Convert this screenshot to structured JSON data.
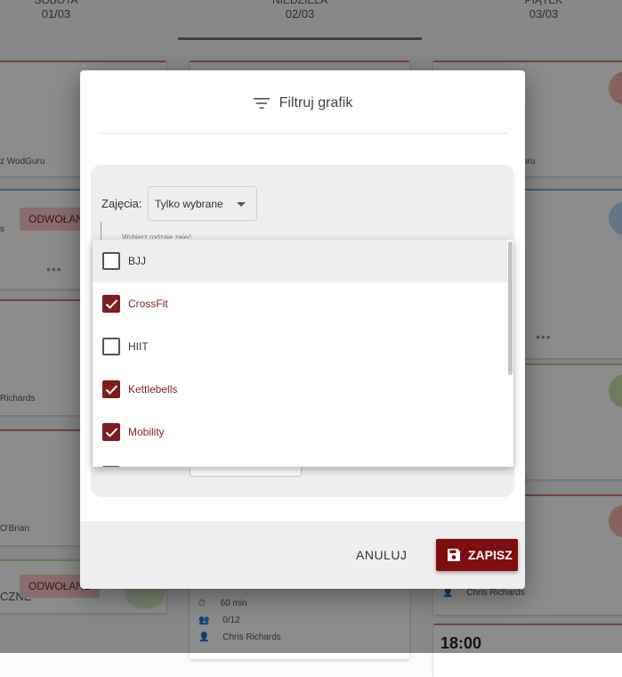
{
  "schedule": {
    "days": [
      {
        "name": "SOBOTA",
        "date": "01/03"
      },
      {
        "name": "NIEDZIELA",
        "date": "02/03"
      },
      {
        "name": "PIĄTEK",
        "date": "03/03"
      }
    ],
    "left_texts": [
      "z WodGuru",
      "s",
      "Richards",
      "O'Brian",
      "CZNE"
    ],
    "right_texts": [
      "uru"
    ],
    "cancelled_label": "ODWOŁANE",
    "bottom_card": {
      "duration": "60 min",
      "capacity": "0/12",
      "coach": "Chris Richards"
    },
    "right_coach": "Chris Richards",
    "right_time": "18:00"
  },
  "dialog": {
    "title": "Filtruj grafik",
    "classes_label": "Zajęcia:",
    "classes_value": "Tylko wybrane",
    "hint": "Wybierz rodzaje zajęć",
    "cancel_label": "ANULUJ",
    "save_label": "ZAPISZ"
  },
  "options": [
    {
      "label": "BJJ",
      "checked": false
    },
    {
      "label": "CrossFit",
      "checked": true
    },
    {
      "label": "HIIT",
      "checked": false
    },
    {
      "label": "Kettlebells",
      "checked": true
    },
    {
      "label": "Mobility",
      "checked": true
    }
  ],
  "colors": {
    "accent": "#7f0e0e",
    "checkbox": "#7f1d1d",
    "cancelled_bg": "#f7c9c9"
  }
}
